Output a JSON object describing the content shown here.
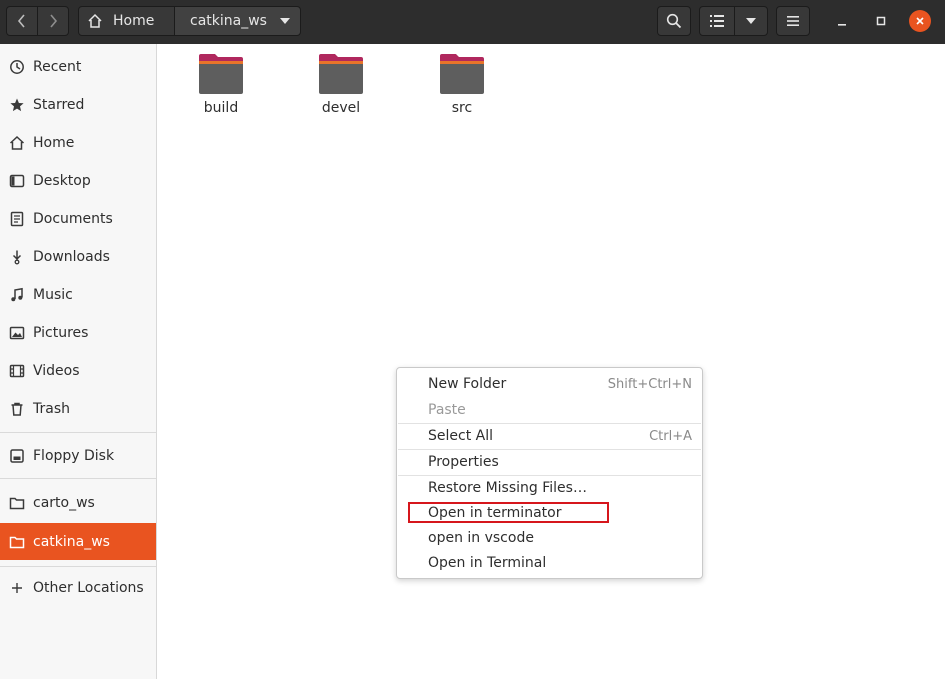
{
  "header": {
    "breadcrumb_home": "Home",
    "breadcrumb_current": "catkina_ws"
  },
  "sidebar": {
    "items": [
      {
        "label": "Recent",
        "icon": "clock-icon"
      },
      {
        "label": "Starred",
        "icon": "star-icon"
      },
      {
        "label": "Home",
        "icon": "home-icon"
      },
      {
        "label": "Desktop",
        "icon": "desktop-icon"
      },
      {
        "label": "Documents",
        "icon": "document-icon"
      },
      {
        "label": "Downloads",
        "icon": "download-icon"
      },
      {
        "label": "Music",
        "icon": "music-icon"
      },
      {
        "label": "Pictures",
        "icon": "picture-icon"
      },
      {
        "label": "Videos",
        "icon": "video-icon"
      },
      {
        "label": "Trash",
        "icon": "trash-icon"
      },
      {
        "label": "Floppy Disk",
        "icon": "drive-icon"
      },
      {
        "label": "carto_ws",
        "icon": "folder-icon"
      },
      {
        "label": "catkina_ws",
        "icon": "folder-icon",
        "active": true
      },
      {
        "label": "Other Locations",
        "icon": "plus-icon"
      }
    ]
  },
  "files": [
    {
      "name": "build"
    },
    {
      "name": "devel"
    },
    {
      "name": "src"
    }
  ],
  "context_menu": {
    "items": [
      {
        "label": "New Folder",
        "accel": "Shift+Ctrl+N"
      },
      {
        "label": "Paste",
        "accel": "",
        "disabled": true
      },
      {
        "label": "Select All",
        "accel": "Ctrl+A"
      },
      {
        "label": "Properties",
        "accel": ""
      },
      {
        "label": "Restore Missing Files…",
        "accel": ""
      },
      {
        "label": "Open in terminator",
        "accel": "",
        "highlighted": true
      },
      {
        "label": "open in vscode",
        "accel": ""
      },
      {
        "label": "Open in Terminal",
        "accel": ""
      }
    ]
  },
  "colors": {
    "accent": "#e95420",
    "header_bg": "#2d2d2d",
    "highlight_box": "#d6161c"
  }
}
